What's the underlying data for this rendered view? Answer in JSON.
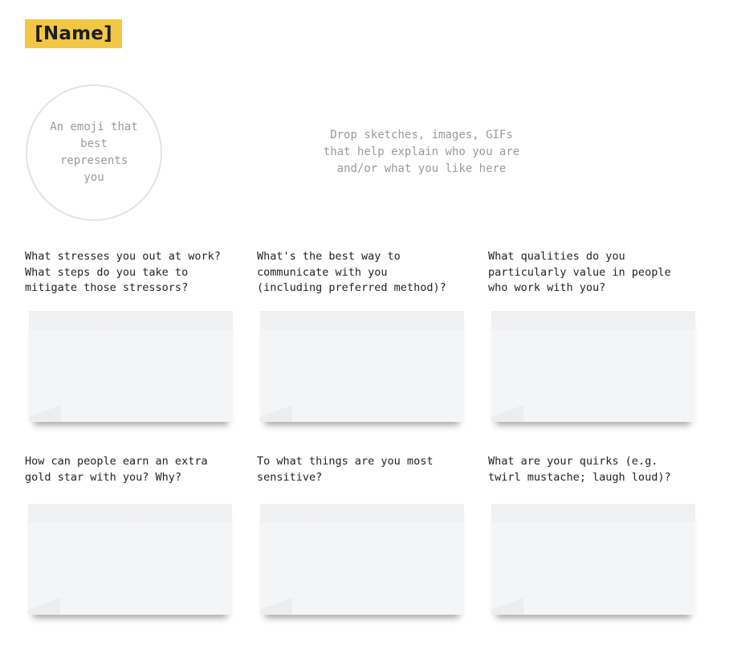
{
  "header": {
    "name_label": "[Name]"
  },
  "emoji_placeholder": "An emoji that best represents you",
  "drop_zone": {
    "line1": "Drop sketches, images, GIFs",
    "line2": "that help explain who you are",
    "line3": "and/or what you like here"
  },
  "questions": [
    {
      "line1": "What stresses you out at work?",
      "line2": "What steps do you take to",
      "line3": "mitigate those stressors?"
    },
    {
      "line1": "What's the best way to",
      "line2": "communicate with you",
      "line3": "(including preferred method)?"
    },
    {
      "line1": "What qualities do you",
      "line2": "particularly value in people",
      "line3": "who work with you?"
    },
    {
      "line1": "How can people earn an extra",
      "line2": "gold star with you? Why?",
      "line3": ""
    },
    {
      "line1": "To what things are you most",
      "line2": "sensitive?",
      "line3": ""
    },
    {
      "line1": "What are your quirks (e.g.",
      "line2": "twirl mustache; laugh loud)?",
      "line3": ""
    }
  ],
  "colors": {
    "name_tag": "#f2c744",
    "placeholder_text": "#9a9a9a",
    "note_fill": "#f4f5f7"
  }
}
